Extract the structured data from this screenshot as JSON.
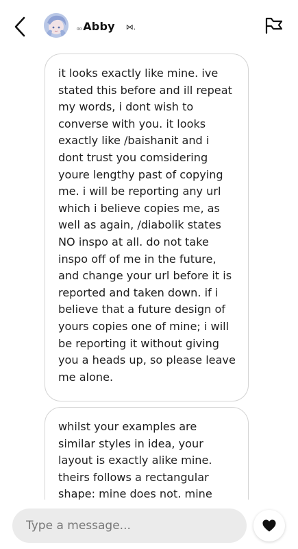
{
  "header": {
    "name_prefix": "₀₀",
    "name": "Abby",
    "name_suffix": "⋈.",
    "back_icon": "chevron-left-icon",
    "flag_icon": "flag-icon"
  },
  "messages": [
    {
      "text": "it looks exactly like mine. ive stated this before and ill repeat my words, i dont wish to converse with you. it looks exactly like /baishanit and i dont trust you comsidering youre lengthy past of copying me. i will be reporting any url which i believe copies me, as well as again, /diabolik states NO inspo at all. do not take inspo off of me in the future, and change your url before it is reported and taken down. if i believe that a future design of yours copies one of mine; i will be reporting it without giving you a heads up, so please leave me alone."
    },
    {
      "text": "whilst your examples are similar styles in idea, your layout is exactly alike mine. theirs follows a rectangular shape: mine does not. mine"
    }
  ],
  "composer": {
    "placeholder": "Type a message...",
    "heart_icon": "heart-icon"
  },
  "colors": {
    "bubble_border": "#d3d3d3",
    "input_bg": "#ebebeb",
    "text": "#1e1e1e"
  }
}
